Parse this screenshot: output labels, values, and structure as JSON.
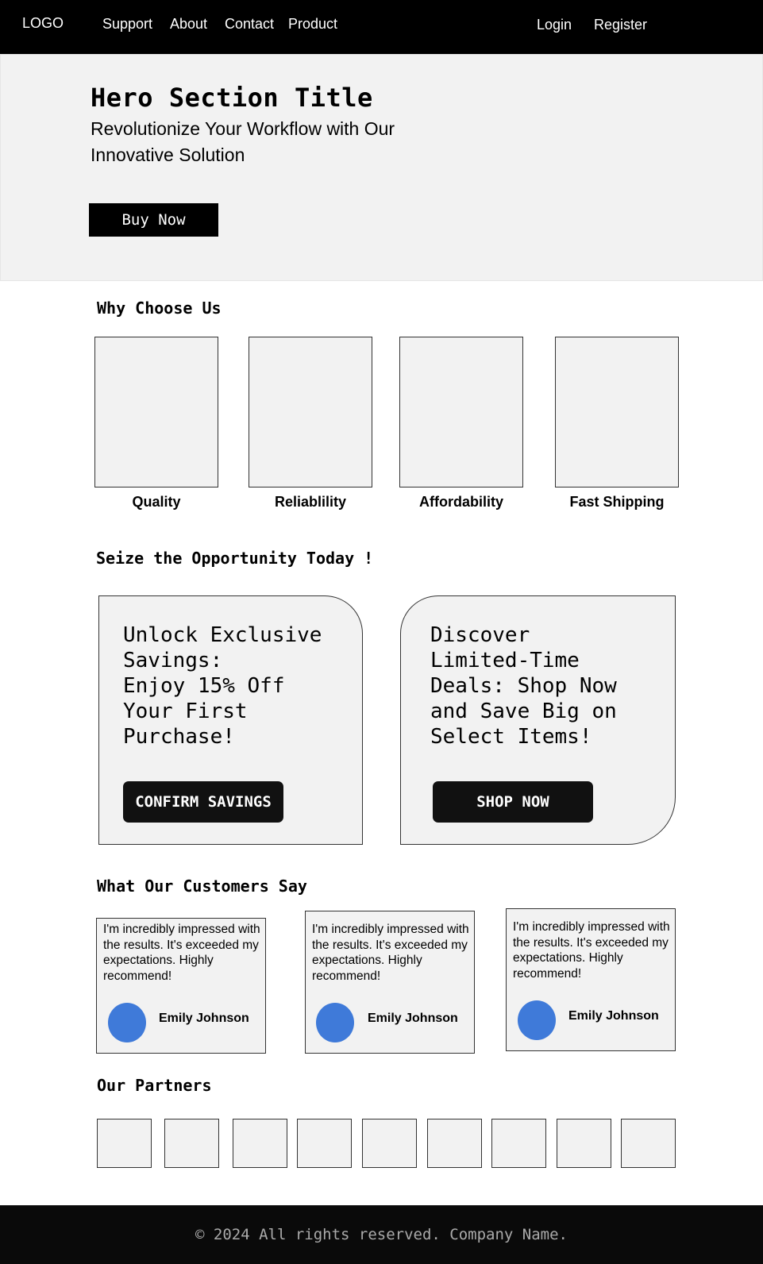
{
  "header": {
    "logo": "LOGO",
    "nav": [
      "Support",
      "About",
      "Contact",
      "Product"
    ],
    "login": "Login",
    "register": "Register"
  },
  "hero": {
    "title": "Hero Section Title",
    "subtitle": "Revolutionize Your Workflow with Our Innovative Solution",
    "cta": "Buy Now"
  },
  "why": {
    "title": "Why Choose Us",
    "features": [
      "Quality",
      "Reliablility",
      "Affordability",
      "Fast Shipping"
    ]
  },
  "offers": {
    "title": "Seize the Opportunity Today !",
    "cards": [
      {
        "text": "Unlock Exclusive\nSavings:\nEnjoy 15% Off\nYour First\nPurchase!",
        "button": "CONFIRM SAVINGS"
      },
      {
        "text": "Discover\nLimited-Time\nDeals: Shop Now\nand Save Big on\nSelect Items!",
        "button": "SHOP NOW"
      }
    ]
  },
  "testimonials": {
    "title": "What Our Customers Say",
    "items": [
      {
        "quote": "I'm incredibly impressed with the results. It's exceeded my expectations. Highly recommend!",
        "name": "Emily Johnson"
      },
      {
        "quote": "I'm incredibly impressed with the results. It's exceeded my expectations. Highly recommend!",
        "name": "Emily Johnson"
      },
      {
        "quote": "I'm incredibly impressed with the results. It's exceeded my expectations. Highly recommend!",
        "name": "Emily Johnson"
      }
    ],
    "avatar_color": "#3f7ad9"
  },
  "partners": {
    "title": "Our Partners"
  },
  "footer": {
    "text": "© 2024 All rights reserved. Company Name."
  }
}
